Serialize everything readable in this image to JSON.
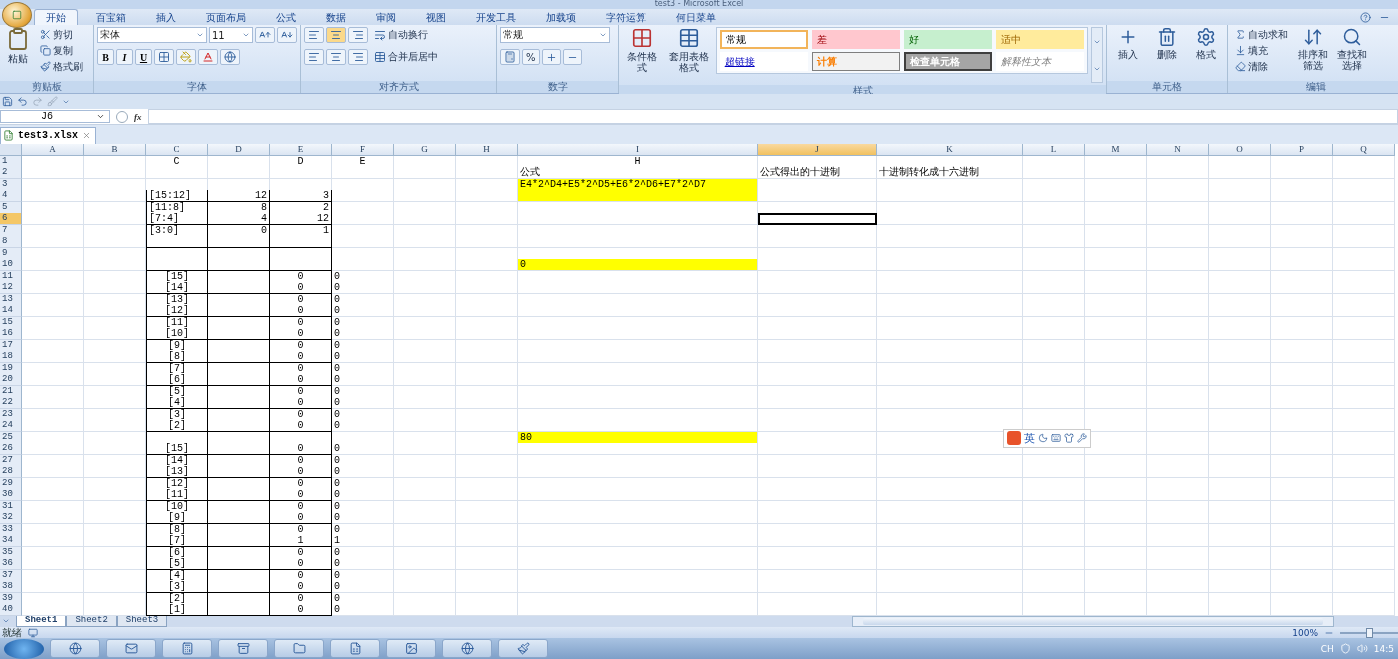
{
  "window": {
    "title": "test3 - Microsoft Excel"
  },
  "tabs": [
    {
      "label": "开始",
      "selected": true
    },
    {
      "label": "百宝箱",
      "selected": false
    },
    {
      "label": "插入",
      "selected": false
    },
    {
      "label": "页面布局",
      "selected": false
    },
    {
      "label": "公式",
      "selected": false
    },
    {
      "label": "数据",
      "selected": false
    },
    {
      "label": "审阅",
      "selected": false
    },
    {
      "label": "视图",
      "selected": false
    },
    {
      "label": "开发工具",
      "selected": false
    },
    {
      "label": "加载项",
      "selected": false
    },
    {
      "label": "字符运算",
      "selected": false
    },
    {
      "label": "何日菜单",
      "selected": false
    }
  ],
  "ribbon": {
    "groups": [
      {
        "kind": "clipboard",
        "label": "剪贴板",
        "big": "粘贴",
        "items": [
          "剪切",
          "复制",
          "格式刷"
        ]
      },
      {
        "kind": "font",
        "label": "字体",
        "font": "宋体",
        "size": "11",
        "format_buttons": [
          "B",
          "I",
          "U"
        ]
      },
      {
        "kind": "alignment",
        "label": "对齐方式",
        "items": [
          "自动换行",
          "合并后居中"
        ]
      },
      {
        "kind": "number",
        "label": "数字",
        "format": "常规",
        "percent": "%"
      },
      {
        "kind": "styles",
        "label": "样式",
        "big": [
          "条件格式",
          "套用表格格式"
        ],
        "styles": [
          {
            "text": "常规",
            "kind": "normal"
          },
          {
            "text": "差",
            "kind": "bad"
          },
          {
            "text": "好",
            "kind": "good"
          },
          {
            "text": "适中",
            "kind": "neutral"
          },
          {
            "text": "超链接",
            "kind": "link"
          },
          {
            "text": "计算",
            "kind": "calc"
          },
          {
            "text": "检查单元格",
            "kind": "check"
          },
          {
            "text": "解释性文本",
            "kind": "note"
          }
        ]
      },
      {
        "kind": "cells",
        "label": "单元格",
        "big": [
          "插入",
          "删除",
          "格式"
        ]
      },
      {
        "kind": "editing",
        "label": "编辑",
        "items": [
          "自动求和",
          "填充",
          "清除"
        ],
        "big": [
          "排序和筛选",
          "查找和选择"
        ]
      }
    ]
  },
  "formula_bar": {
    "name_box": "J6",
    "fx": "fx"
  },
  "workbook_tab": {
    "label": "test3.xlsx"
  },
  "grid": {
    "columns": [
      "A",
      "B",
      "C",
      "D",
      "E",
      "F",
      "G",
      "H",
      "I",
      "J",
      "K",
      "L",
      "M",
      "N",
      "O",
      "P",
      "Q"
    ],
    "rows": [
      {
        "num": "1",
        "kind": "caption",
        "cells": {
          "C": {
            "text": "C"
          },
          "E": {
            "text": "D"
          },
          "F": {
            "text": "E"
          },
          "I": {
            "text": "H"
          }
        }
      },
      {
        "num": "2",
        "kind": "plain",
        "cells": {
          "I": {
            "text": "公式"
          },
          "J": {
            "text": "公式得出的十进制"
          },
          "K": {
            "text": "十进制转化成十六进制"
          }
        }
      },
      {
        "num": "3",
        "kind": "plain",
        "cells": {
          "I": {
            "text": "E4*2^D4+E5*2^D5+E6*2^D6+E7*2^D7",
            "highlighted": true
          }
        }
      },
      {
        "num": "4",
        "kind": "nibble",
        "cells": {
          "C": {
            "text": "[15:12]"
          },
          "D": {
            "text": "12"
          },
          "E": {
            "text": "3"
          },
          "I": {
            "highlighted": true
          }
        }
      },
      {
        "num": "5",
        "kind": "nibble",
        "cells": {
          "C": {
            "text": "[11:8]"
          },
          "D": {
            "text": "8"
          },
          "E": {
            "text": "2"
          }
        }
      },
      {
        "num": "6",
        "kind": "nibble",
        "cells": {
          "C": {
            "text": "[7:4]"
          },
          "D": {
            "text": "4"
          },
          "E": {
            "text": "12"
          },
          "J": {
            "selected": true
          }
        }
      },
      {
        "num": "7",
        "kind": "nibble",
        "cells": {
          "C": {
            "text": "[3:0]"
          },
          "D": {
            "text": "0"
          },
          "E": {
            "text": "1"
          }
        }
      },
      {
        "num": "8",
        "kind": "box",
        "cells": {}
      },
      {
        "num": "9",
        "kind": "box",
        "cells": {}
      },
      {
        "num": "10",
        "kind": "box",
        "cells": {
          "I": {
            "text": "0",
            "highlighted": true
          }
        }
      },
      {
        "num": "11",
        "kind": "bit",
        "cells": {
          "C": {
            "text": "[15]"
          },
          "E": {
            "text": "0"
          },
          "F": {
            "text": "0"
          }
        }
      },
      {
        "num": "12",
        "kind": "bit",
        "cells": {
          "C": {
            "text": "[14]"
          },
          "E": {
            "text": "0"
          },
          "F": {
            "text": "0"
          }
        }
      },
      {
        "num": "13",
        "kind": "bit",
        "cells": {
          "C": {
            "text": "[13]"
          },
          "E": {
            "text": "0"
          },
          "F": {
            "text": "0"
          }
        }
      },
      {
        "num": "14",
        "kind": "bit",
        "cells": {
          "C": {
            "text": "[12]"
          },
          "E": {
            "text": "0"
          },
          "F": {
            "text": "0"
          }
        }
      },
      {
        "num": "15",
        "kind": "bit",
        "cells": {
          "C": {
            "text": "[11]"
          },
          "E": {
            "text": "0"
          },
          "F": {
            "text": "0"
          }
        }
      },
      {
        "num": "16",
        "kind": "bit",
        "cells": {
          "C": {
            "text": "[10]"
          },
          "E": {
            "text": "0"
          },
          "F": {
            "text": "0"
          }
        }
      },
      {
        "num": "17",
        "kind": "bit",
        "cells": {
          "C": {
            "text": "[9]"
          },
          "E": {
            "text": "0"
          },
          "F": {
            "text": "0"
          }
        }
      },
      {
        "num": "18",
        "kind": "bit",
        "cells": {
          "C": {
            "text": "[8]"
          },
          "E": {
            "text": "0"
          },
          "F": {
            "text": "0"
          }
        }
      },
      {
        "num": "19",
        "kind": "bit",
        "cells": {
          "C": {
            "text": "[7]"
          },
          "E": {
            "text": "0"
          },
          "F": {
            "text": "0"
          }
        }
      },
      {
        "num": "20",
        "kind": "bit",
        "cells": {
          "C": {
            "text": "[6]"
          },
          "E": {
            "text": "0"
          },
          "F": {
            "text": "0"
          }
        }
      },
      {
        "num": "21",
        "kind": "bit",
        "cells": {
          "C": {
            "text": "[5]"
          },
          "E": {
            "text": "0"
          },
          "F": {
            "text": "0"
          }
        }
      },
      {
        "num": "22",
        "kind": "bit",
        "cells": {
          "C": {
            "text": "[4]"
          },
          "E": {
            "text": "0"
          },
          "F": {
            "text": "0"
          }
        }
      },
      {
        "num": "23",
        "kind": "bit",
        "cells": {
          "C": {
            "text": "[3]"
          },
          "E": {
            "text": "0"
          },
          "F": {
            "text": "0"
          }
        }
      },
      {
        "num": "24",
        "kind": "bit",
        "cells": {
          "C": {
            "text": "[2]"
          },
          "E": {
            "text": "0"
          },
          "F": {
            "text": "0"
          }
        }
      },
      {
        "num": "25",
        "kind": "box",
        "cells": {
          "I": {
            "text": "80",
            "highlighted": true
          }
        }
      },
      {
        "num": "26",
        "kind": "bit",
        "cells": {
          "C": {
            "text": "[15]"
          },
          "E": {
            "text": "0"
          },
          "F": {
            "text": "0"
          }
        }
      },
      {
        "num": "27",
        "kind": "bit",
        "cells": {
          "C": {
            "text": "[14]"
          },
          "E": {
            "text": "0"
          },
          "F": {
            "text": "0"
          }
        }
      },
      {
        "num": "28",
        "kind": "bit",
        "cells": {
          "C": {
            "text": "[13]"
          },
          "E": {
            "text": "0"
          },
          "F": {
            "text": "0"
          }
        }
      },
      {
        "num": "29",
        "kind": "bit",
        "cells": {
          "C": {
            "text": "[12]"
          },
          "E": {
            "text": "0"
          },
          "F": {
            "text": "0"
          }
        }
      },
      {
        "num": "30",
        "kind": "bit",
        "cells": {
          "C": {
            "text": "[11]"
          },
          "E": {
            "text": "0"
          },
          "F": {
            "text": "0"
          }
        }
      },
      {
        "num": "31",
        "kind": "bit",
        "cells": {
          "C": {
            "text": "[10]"
          },
          "E": {
            "text": "0"
          },
          "F": {
            "text": "0"
          }
        }
      },
      {
        "num": "32",
        "kind": "bit",
        "cells": {
          "C": {
            "text": "[9]"
          },
          "E": {
            "text": "0"
          },
          "F": {
            "text": "0"
          }
        }
      },
      {
        "num": "33",
        "kind": "bit",
        "cells": {
          "C": {
            "text": "[8]"
          },
          "E": {
            "text": "0"
          },
          "F": {
            "text": "0"
          }
        }
      },
      {
        "num": "34",
        "kind": "bit",
        "cells": {
          "C": {
            "text": "[7]"
          },
          "E": {
            "text": "1"
          },
          "F": {
            "text": "1"
          }
        }
      },
      {
        "num": "35",
        "kind": "bit",
        "cells": {
          "C": {
            "text": "[6]"
          },
          "E": {
            "text": "0"
          },
          "F": {
            "text": "0"
          }
        }
      },
      {
        "num": "36",
        "kind": "bit",
        "cells": {
          "C": {
            "text": "[5]"
          },
          "E": {
            "text": "0"
          },
          "F": {
            "text": "0"
          }
        }
      },
      {
        "num": "37",
        "kind": "bit",
        "cells": {
          "C": {
            "text": "[4]"
          },
          "E": {
            "text": "0"
          },
          "F": {
            "text": "0"
          }
        }
      },
      {
        "num": "38",
        "kind": "bit",
        "cells": {
          "C": {
            "text": "[3]"
          },
          "E": {
            "text": "0"
          },
          "F": {
            "text": "0"
          }
        }
      },
      {
        "num": "39",
        "kind": "bit",
        "cells": {
          "C": {
            "text": "[2]"
          },
          "E": {
            "text": "0"
          },
          "F": {
            "text": "0"
          }
        }
      },
      {
        "num": "40",
        "kind": "bit",
        "cells": {
          "C": {
            "text": "[1]"
          },
          "E": {
            "text": "0"
          },
          "F": {
            "text": "0"
          }
        }
      }
    ]
  },
  "ime_bar": {
    "label": "英"
  },
  "sheet_tabs": [
    {
      "label": "Sheet1",
      "selected": true
    },
    {
      "label": "Sheet2",
      "selected": false
    },
    {
      "label": "Sheet3",
      "selected": false
    }
  ],
  "status_bar": {
    "status": "就绪",
    "zoom": "100%",
    "zoom_slider": {
      "level": 0.5
    }
  },
  "taskbar": {
    "language": "CH",
    "time": "14:5"
  }
}
